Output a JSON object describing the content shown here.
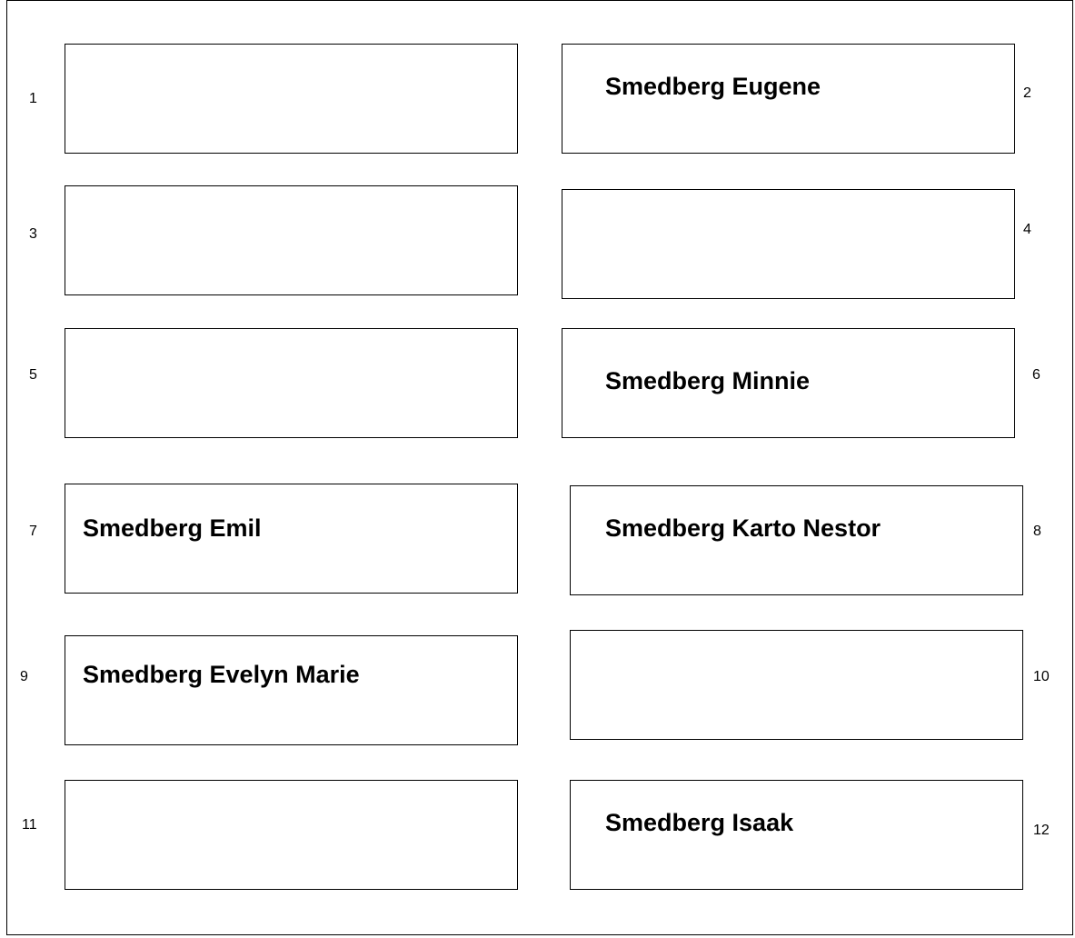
{
  "slots": [
    {
      "number": "1",
      "name": ""
    },
    {
      "number": "2",
      "name": "Smedberg Eugene"
    },
    {
      "number": "3",
      "name": ""
    },
    {
      "number": "4",
      "name": ""
    },
    {
      "number": "5",
      "name": ""
    },
    {
      "number": "6",
      "name": "Smedberg Minnie"
    },
    {
      "number": "7",
      "name": "Smedberg Emil"
    },
    {
      "number": "8",
      "name": "Smedberg Karto Nestor"
    },
    {
      "number": "9",
      "name": "Smedberg Evelyn Marie"
    },
    {
      "number": "10",
      "name": ""
    },
    {
      "number": "11",
      "name": ""
    },
    {
      "number": "12",
      "name": "Smedberg Isaak"
    }
  ]
}
